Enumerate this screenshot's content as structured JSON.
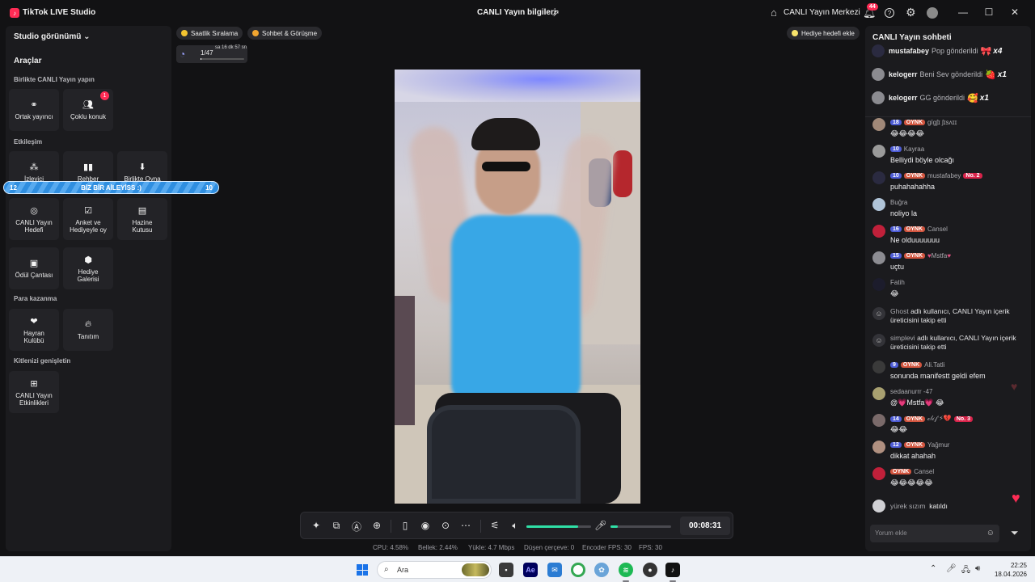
{
  "titlebar": {
    "app_title": "TikTok LIVE Studio",
    "center_title": "CANLI Yayın bilgileri",
    "live_center": "CANLI Yayın Merkezi",
    "notification_count": "44"
  },
  "left": {
    "studio_view": "Studio görünümü",
    "tools_heading": "Araçlar",
    "sections": {
      "together": "Birlikte CANLI Yayın yapın",
      "interaction": "Etkileşim",
      "monetize": "Para kazanma",
      "audience": "Kitlenizi genişletin"
    },
    "tools": {
      "cohost": "Ortak yayıncı",
      "multi_guest": "Çoklu konuk",
      "multi_guest_badge": "1",
      "viewer": "İzleyici",
      "guide": "Rehber",
      "play_together": "Birlikte Oyna",
      "live_goal_1": "CANLI Yayın",
      "live_goal_2": "Hedefi",
      "poll_1": "Anket ve",
      "poll_2": "Hediyeyle oy",
      "treasure_1": "Hazine",
      "treasure_2": "Kutusu",
      "reward_bag": "Ödül Çantası",
      "gift_gallery_1": "Hediye",
      "gift_gallery_2": "Galerisi",
      "fan_club_1": "Hayran",
      "fan_club_2": "Kulübü",
      "promote": "Tanıtım",
      "events_1": "CANLI Yayın",
      "events_2": "Etkinlikleri"
    },
    "banner": {
      "left": "12",
      "text": "BİZ BİR AİLEYİSS :)",
      "right": "10"
    }
  },
  "chips": {
    "hourly": "Saatlik Sıralama",
    "chat_meet": "Sohbet & Görüşme",
    "gift_goal": "Hediye hedefi ekle"
  },
  "goal": {
    "count": "1/47",
    "time": "sa 16 dk 57 sn",
    "progress": 0.02
  },
  "controls": {
    "timer": "00:08:31",
    "volume": 0.8,
    "mic": 0.12
  },
  "stats": {
    "cpu": "CPU:  4.58%",
    "memory": "Bellek:  2.44%",
    "upload": "Yükle:  4.7 Mbps",
    "dropped": "Düşen çerçeve:  0",
    "encoder": "Encoder FPS:  30",
    "fps": "FPS:  30"
  },
  "chat": {
    "title": "CANLI Yayın sohbeti",
    "gifts": [
      {
        "user": "mustafabey",
        "text": "Pop gönderildi",
        "count": "x4",
        "icon": "🎀"
      },
      {
        "user": "kelogerr",
        "text": "Beni Sev gönderildi",
        "count": "x1",
        "icon": "🍓"
      },
      {
        "user": "kelogerr",
        "text": "GG gönderildi",
        "count": "x1",
        "icon": "🥰"
      }
    ],
    "messages": [
      {
        "lvl": "18",
        "fan": "OYNK",
        "user": "ɡīɡʃɪ  ʃɪsʌɪɪ",
        "text": "😂😂😂😂"
      },
      {
        "lvl": "10",
        "fan": "",
        "user": "Kayraa",
        "text": "Belliydi böyle olcağı"
      },
      {
        "lvl": "10",
        "fan": "OYNK",
        "user": "mustafabey",
        "rank": "No. 2",
        "text": "puhahahahha"
      },
      {
        "lvl": "",
        "fan": "",
        "user": "Buğra",
        "text": "noliyo la"
      },
      {
        "lvl": "16",
        "fan": "OYNK",
        "user": "Cansel",
        "text": "Ne olduuuuuuu"
      },
      {
        "lvl": "15",
        "fan": "OYNK",
        "user": "Mstfa",
        "text": "uçtu"
      },
      {
        "lvl": "",
        "fan": "",
        "user": "Fatih",
        "text": "😂"
      }
    ],
    "follows": [
      {
        "user": "Ghost",
        "text": "adlı kullanıcı, CANLI Yayın içerik üreticisini takip etti"
      },
      {
        "user": "simplevi",
        "text": "adlı kullanıcı, CANLI Yayın içerik üreticisini takip etti"
      }
    ],
    "messages2": [
      {
        "lvl": "9",
        "fan": "OYNK",
        "user": "Ali.Tatli",
        "text": "sonunda manifestt geldi efem"
      },
      {
        "lvl": "",
        "fan": "",
        "user": "sedaanurrr -47",
        "text": "@💗Mstfa💗 😂"
      },
      {
        "lvl": "14",
        "fan": "OYNK",
        "user": "𝒸𝓁𝒾𝒻 ⚡💔",
        "rank": "No. 3",
        "text": "😂😂"
      },
      {
        "lvl": "12",
        "fan": "OYNK",
        "user": "Yağmur",
        "text": "dikkat ahahah"
      },
      {
        "lvl": "",
        "fan": "OYNK",
        "user": "Cansel",
        "text": "😂😂😂😂😂"
      }
    ],
    "joined": {
      "user": "yürek sızım",
      "text": "katıldı"
    },
    "comment_placeholder": "Yorum ekle"
  },
  "taskbar": {
    "search_placeholder": "Ara",
    "time": "22:25",
    "date": "18.04.2026"
  }
}
